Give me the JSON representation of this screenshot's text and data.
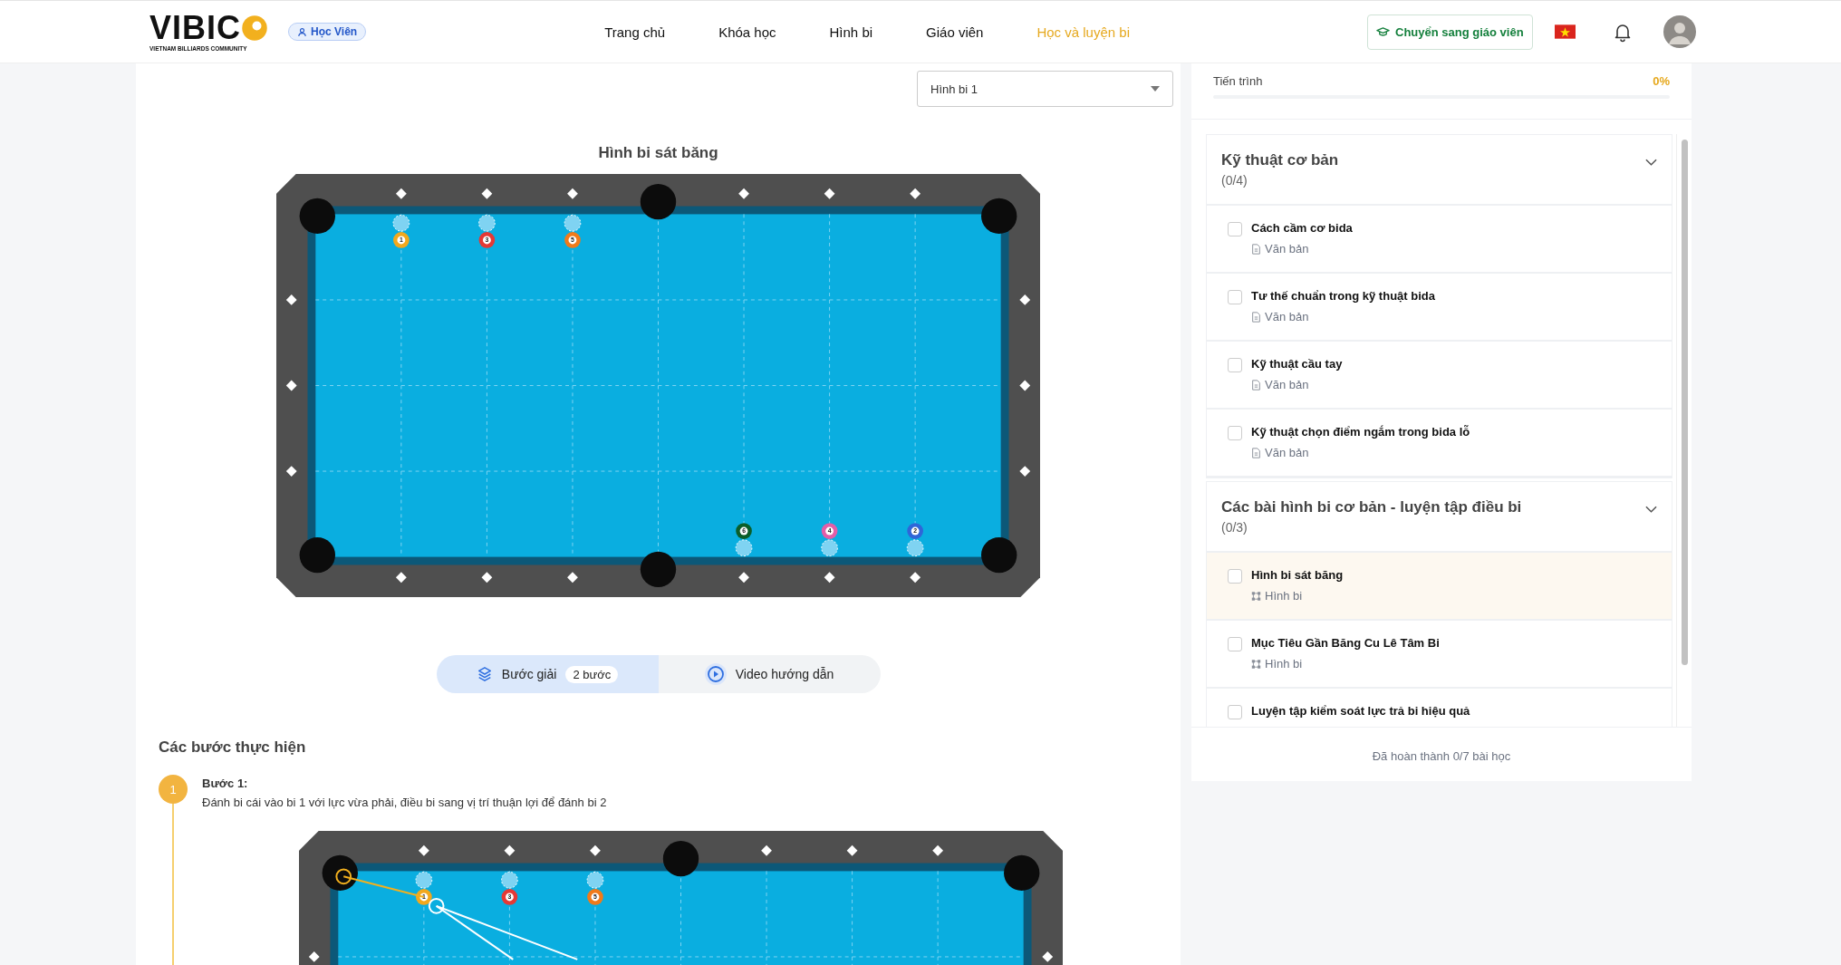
{
  "header": {
    "logo": {
      "text": "VIBIC",
      "tagline": "VIETNAM BILLIARDS COMMUNITY"
    },
    "role_badge": "Học Viên",
    "nav": [
      {
        "label": "Trang chủ",
        "selected": false
      },
      {
        "label": "Khóa học",
        "selected": false
      },
      {
        "label": "Hình bi",
        "selected": false
      },
      {
        "label": "Giáo viên",
        "selected": false
      },
      {
        "label": "Học và luyện bi",
        "selected": true
      }
    ],
    "switch_button": "Chuyển sang giáo viên"
  },
  "puzzle": {
    "select": {
      "value": "Hình bi 1"
    },
    "title": "Hình bi sát băng",
    "table": {
      "balls": [
        {
          "number": "1",
          "color": "#f2a81d"
        },
        {
          "number": "3",
          "color": "#e53935"
        },
        {
          "number": "5",
          "color": "#f07a1a"
        },
        {
          "number": "6",
          "color": "#0b5e2a"
        },
        {
          "number": "4",
          "color": "#e25ea8"
        },
        {
          "number": "2",
          "color": "#2f66d8"
        }
      ]
    },
    "tabs": [
      {
        "label": "Bước giải",
        "badge": "2 bước",
        "kind": "steps",
        "selected": true
      },
      {
        "label": "Video hướng dẫn",
        "kind": "video",
        "selected": false
      }
    ]
  },
  "steps": {
    "heading": "Các bước thực hiện",
    "items": [
      {
        "number": "1",
        "title": "Bước 1:",
        "text": "Đánh bi cái vào bi 1 với lực vừa phải, điều bi sang vị trí thuận lợi để đánh bi 2",
        "table": {
          "balls": [
            {
              "number": "1",
              "color": "#f2a81d"
            },
            {
              "number": "3",
              "color": "#e53935"
            },
            {
              "number": "5",
              "color": "#f07a1a"
            }
          ],
          "shot_lines": true
        }
      }
    ]
  },
  "sidebar": {
    "progress": {
      "label": "Tiến trình",
      "value": "0%",
      "level": 0
    },
    "sections": [
      {
        "title": "Kỹ thuật cơ bản",
        "count": "(0/4)",
        "expanded": true,
        "lessons": [
          {
            "title": "Cách cầm cơ bida",
            "type": "Văn bản",
            "kind": "text",
            "checked": false,
            "selected": false
          },
          {
            "title": "Tư thế chuẩn trong kỹ thuật bida",
            "type": "Văn bản",
            "kind": "text",
            "checked": false,
            "selected": false
          },
          {
            "title": "Kỹ thuật cầu tay",
            "type": "Văn bản",
            "kind": "text",
            "checked": false,
            "selected": false
          },
          {
            "title": "Kỹ thuật chọn điểm ngắm trong bida lỗ",
            "type": "Văn bản",
            "kind": "text",
            "checked": false,
            "selected": false
          }
        ]
      },
      {
        "title": "Các bài hình bi cơ bản - luyện tập điều bi",
        "count": "(0/3)",
        "expanded": true,
        "lessons": [
          {
            "title": "Hình bi sát băng",
            "type": "Hình bi",
            "kind": "diagram",
            "checked": false,
            "selected": true
          },
          {
            "title": "Mục Tiêu Gần Băng Cu Lê Tâm Bi",
            "type": "Hình bi",
            "kind": "diagram",
            "checked": false,
            "selected": false
          },
          {
            "title": "Luyện tập kiểm soát lực trả bi hiệu quả",
            "checked": false,
            "selected": false
          }
        ]
      }
    ],
    "footer": "Đã hoàn thành 0/7 bài học"
  }
}
